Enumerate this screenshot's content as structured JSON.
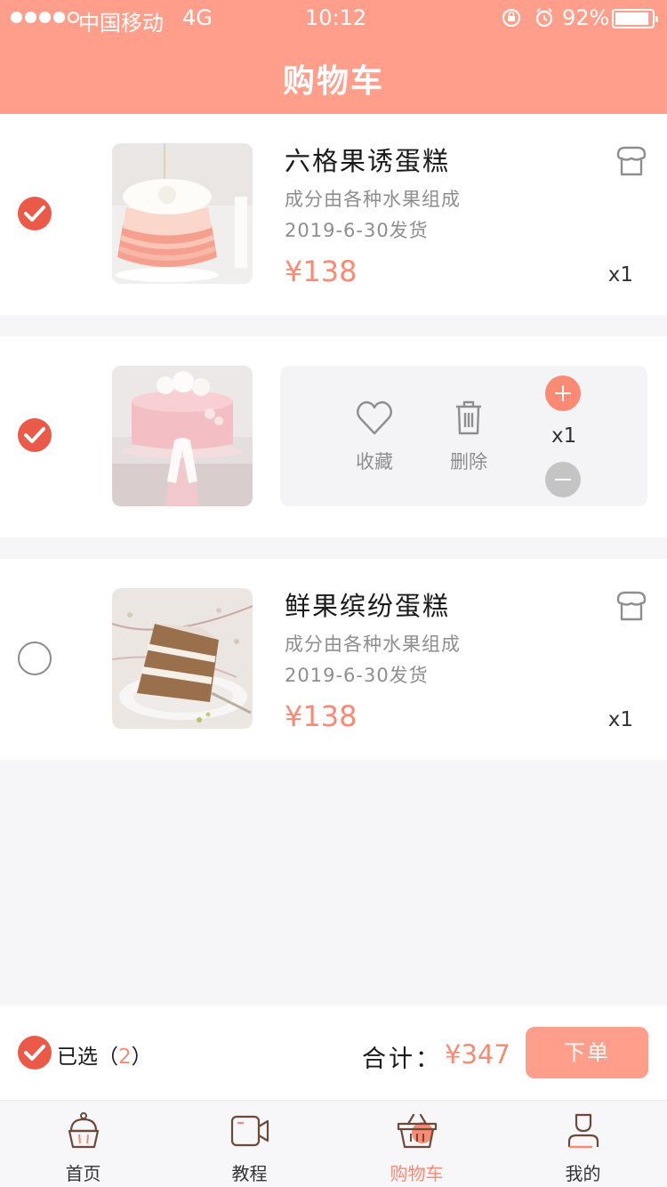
{
  "status_bar": {
    "carrier": "中国移动",
    "network": "4G",
    "time": "10:12",
    "battery": "92%",
    "battery_level": 0.92
  },
  "header": {
    "title": "购物车"
  },
  "cart": {
    "items": [
      {
        "name": "六格果诱蛋糕",
        "description": "成分由各种水果组成",
        "ship_date": "2019-6-30发货",
        "price": "¥138",
        "quantity": "x1",
        "checked": true,
        "image_icon": "ruffle-cake-photo"
      },
      {
        "checked": true,
        "image_icon": "pink-flower-cake-photo",
        "swipe_actions": {
          "favorite_label": "收藏",
          "delete_label": "删除",
          "quantity": "x1"
        }
      },
      {
        "name": "鲜果缤纷蛋糕",
        "description": "成分由各种水果组成",
        "ship_date": "2019-6-30发货",
        "price": "¥138",
        "quantity": "x1",
        "checked": false,
        "image_icon": "layer-cake-slice-photo"
      }
    ]
  },
  "checkout": {
    "selected_label": "已选",
    "open_paren": "（",
    "selected_count": "2",
    "close_paren": "）",
    "total_label": "合计：",
    "total_value": "¥347",
    "order_button": "下单"
  },
  "tabbar": {
    "tabs": [
      {
        "label": "首页",
        "icon": "cupcake-icon",
        "active": false
      },
      {
        "label": "教程",
        "icon": "video-icon",
        "active": false
      },
      {
        "label": "购物车",
        "icon": "basket-icon",
        "active": true
      },
      {
        "label": "我的",
        "icon": "user-icon",
        "active": false
      }
    ]
  },
  "colors": {
    "brand": "#ff9f8b",
    "price": "#fa8a73",
    "check": "#eb5a48"
  }
}
